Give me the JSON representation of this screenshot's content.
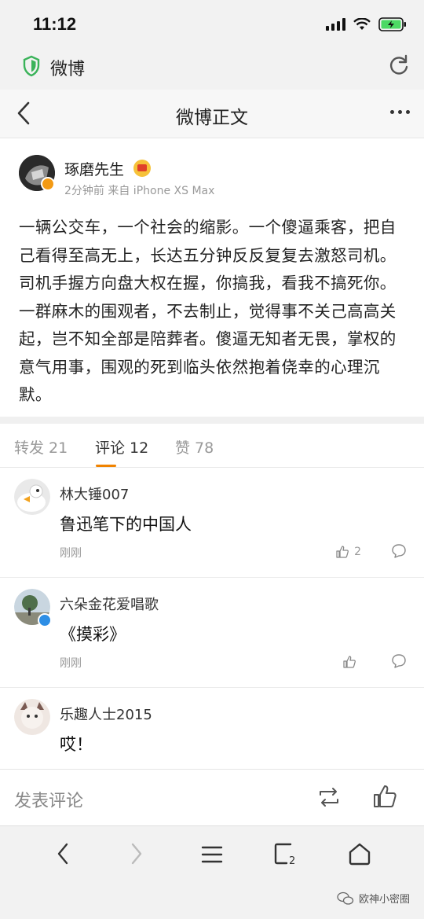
{
  "status_bar": {
    "time": "11:12"
  },
  "browser": {
    "site_title": "微博"
  },
  "header": {
    "title": "微博正文"
  },
  "post": {
    "author": "琢磨先生",
    "meta": "2分钟前 来自 iPhone XS Max",
    "text": "一辆公交车，一个社会的缩影。一个傻逼乘客，把自己看得至高无上，长达五分钟反反复复去激怒司机。司机手握方向盘大权在握，你搞我，看我不搞死你。一群麻木的围观者，不去制止，觉得事不关己高高关起，岂不知全部是陪葬者。傻逼无知者无畏，掌权的意气用事，围观的死到临头依然抱着侥幸的心理沉默。"
  },
  "tabs": [
    {
      "label": "转发 21"
    },
    {
      "label": "评论 12"
    },
    {
      "label": "赞 78"
    }
  ],
  "comments": [
    {
      "name": "林大锤007",
      "text": "鲁迅笔下的中国人",
      "time": "刚刚",
      "likes": "2"
    },
    {
      "name": "六朵金花爱唱歌",
      "text": "《摸彩》",
      "time": "刚刚",
      "likes": ""
    },
    {
      "name": "乐趣人士2015",
      "text": "哎！",
      "time": "",
      "likes": ""
    }
  ],
  "compose": {
    "placeholder": "发表评论"
  },
  "watermark": {
    "text": "欧神小密圈"
  },
  "colors": {
    "accent": "#f08300",
    "verified": "#2d8ee5",
    "shield": "#3bb35a"
  }
}
